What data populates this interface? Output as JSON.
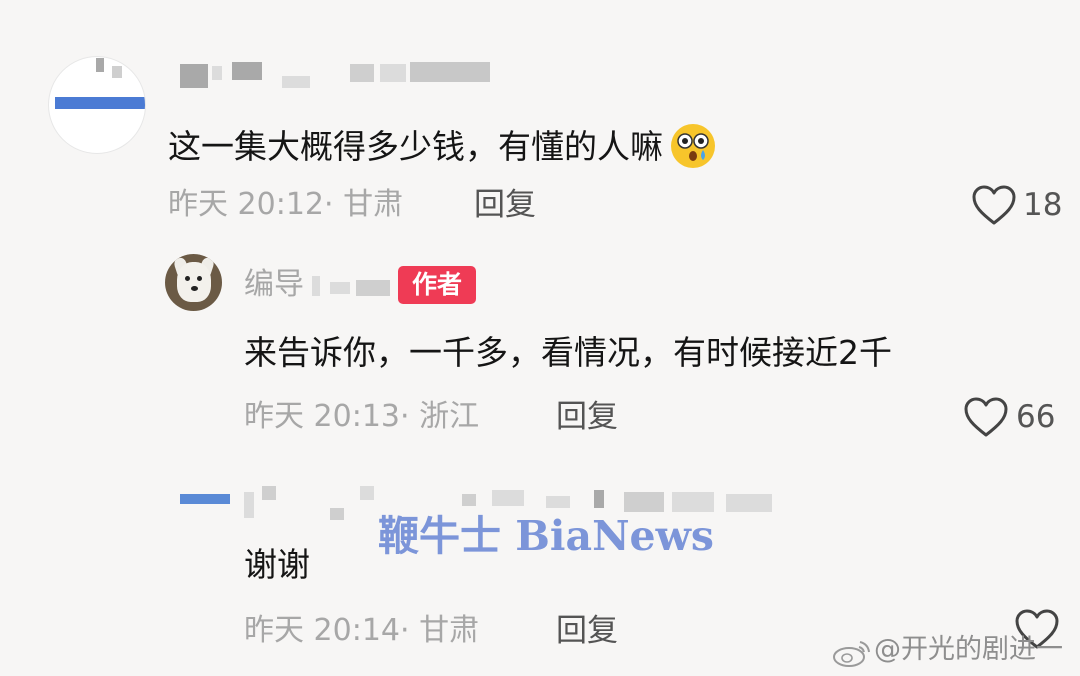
{
  "comments": [
    {
      "text": "这一集大概得多少钱，有懂的人嘛",
      "emoji": "😲",
      "time": "昨天 20:12",
      "location": "甘肃",
      "reply_label": "回复",
      "likes": "18"
    },
    {
      "author": "编导",
      "badge": "作者",
      "text": "来告诉你，一千多，看情况，有时候接近2千",
      "time": "昨天 20:13",
      "location": "浙江",
      "reply_label": "回复",
      "likes": "66"
    },
    {
      "text": "谢谢",
      "time": "昨天 20:14",
      "location": "甘肃",
      "reply_label": "回复"
    }
  ],
  "watermark": "鞭牛士 BiaNews",
  "weibo_mark": "@开光的剧进一",
  "icons": {
    "like": "heart-outline-icon",
    "weibo": "weibo-logo-icon",
    "emoji": "astonished-face-icon"
  },
  "colors": {
    "badge": "#ef3b55",
    "watermark": "#6f8bd6",
    "meta_text": "#a7a7a7"
  }
}
